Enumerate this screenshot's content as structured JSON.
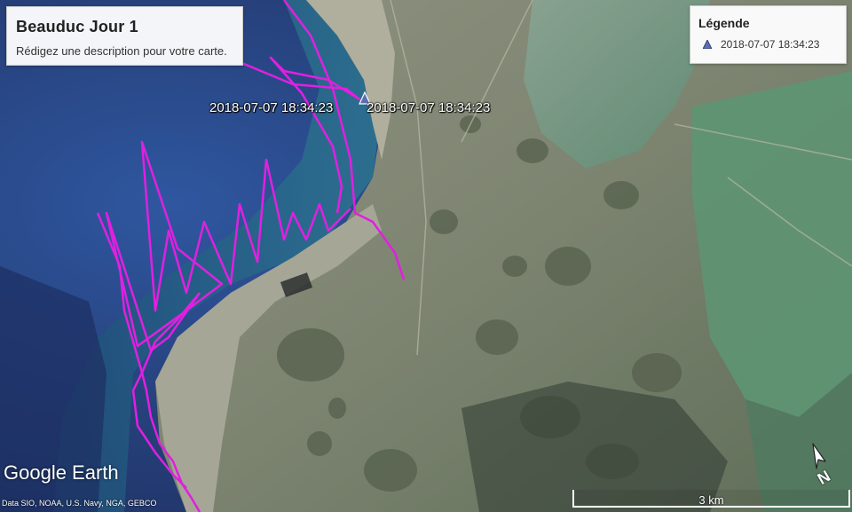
{
  "tour": {
    "title": "Beauduc Jour 1",
    "description": "Rédigez une description pour votre carte."
  },
  "legend": {
    "title": "Légende",
    "items": [
      {
        "label": "2018-07-07 18:34:23",
        "icon": "placemark-triangle-icon",
        "color": "#5b6fb0"
      }
    ]
  },
  "placemarks": [
    {
      "label": "2018-07-07 18:34:23"
    },
    {
      "label": "2018-07-07 18:34:23"
    }
  ],
  "track": {
    "color": "#e020e0"
  },
  "watermark": "Google Earth",
  "credits": "Data SIO, NOAA, U.S. Navy, NGA, GEBCO",
  "scale": {
    "label": "3 km"
  },
  "compass": {
    "label": "N"
  },
  "colors": {
    "sea_deep": "#263c74",
    "sea_shallow": "#3a6f9e",
    "sand": "#9a9c8c",
    "marsh": "#6f7b62",
    "lagoon": "#6f9484"
  }
}
